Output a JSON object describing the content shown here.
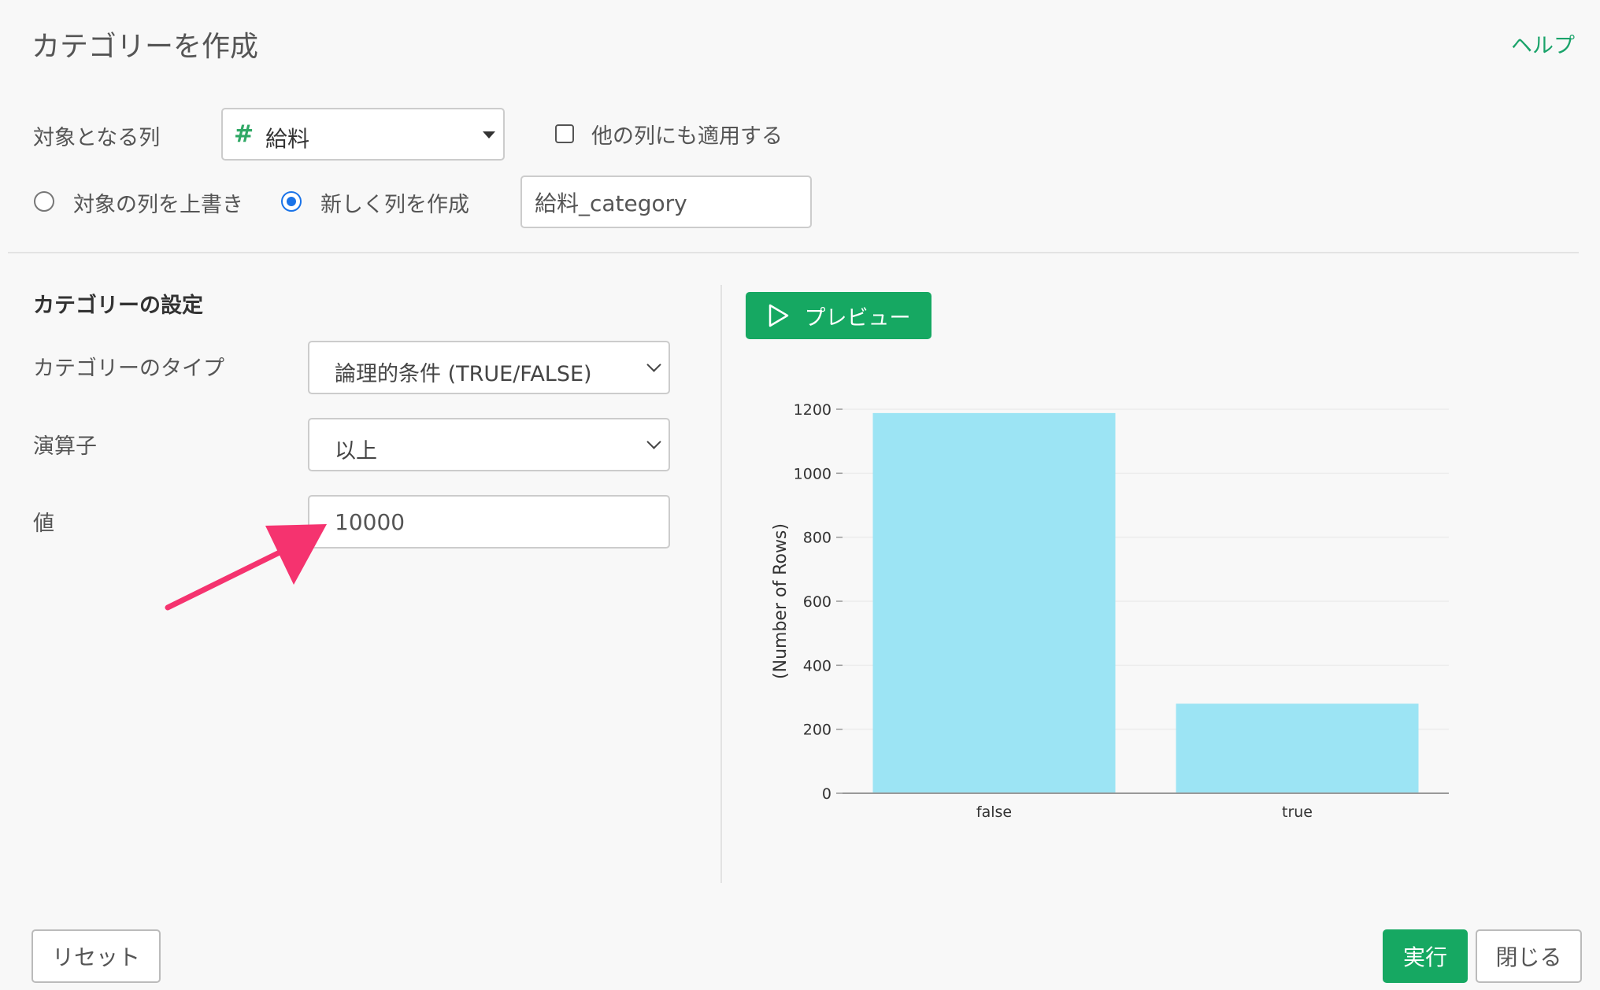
{
  "dialog": {
    "title": "カテゴリーを作成",
    "help_label": "ヘルプ"
  },
  "target": {
    "label": "対象となる列",
    "column_type_icon": "#",
    "column_value": "給料",
    "apply_others_label": "他の列にも適用する",
    "apply_others_checked": false
  },
  "output": {
    "overwrite_label": "対象の列を上書き",
    "new_column_label": "新しく列を作成",
    "selected": "new_column",
    "new_column_name": "給料_category"
  },
  "settings": {
    "section_title": "カテゴリーの設定",
    "category_type_label": "カテゴリーのタイプ",
    "category_type_value": "論理的条件 (TRUE/FALSE)",
    "operator_label": "演算子",
    "operator_value": "以上",
    "value_label": "値",
    "value_value": "10000"
  },
  "preview": {
    "button_label": "プレビュー"
  },
  "footer": {
    "reset_label": "リセット",
    "run_label": "実行",
    "close_label": "閉じる"
  },
  "colors": {
    "accent": "#16a862",
    "bar": "#9ce4f4",
    "arrow": "#f5336f",
    "radio": "#1a73e8"
  },
  "chart_data": {
    "type": "bar",
    "categories": [
      "false",
      "true"
    ],
    "values": [
      1188,
      280
    ],
    "ylabel": "(Number of Rows)",
    "xlabel": "",
    "ylim": [
      0,
      1200
    ],
    "yticks": [
      0,
      200,
      400,
      600,
      800,
      1000,
      1200
    ],
    "grid": true
  }
}
